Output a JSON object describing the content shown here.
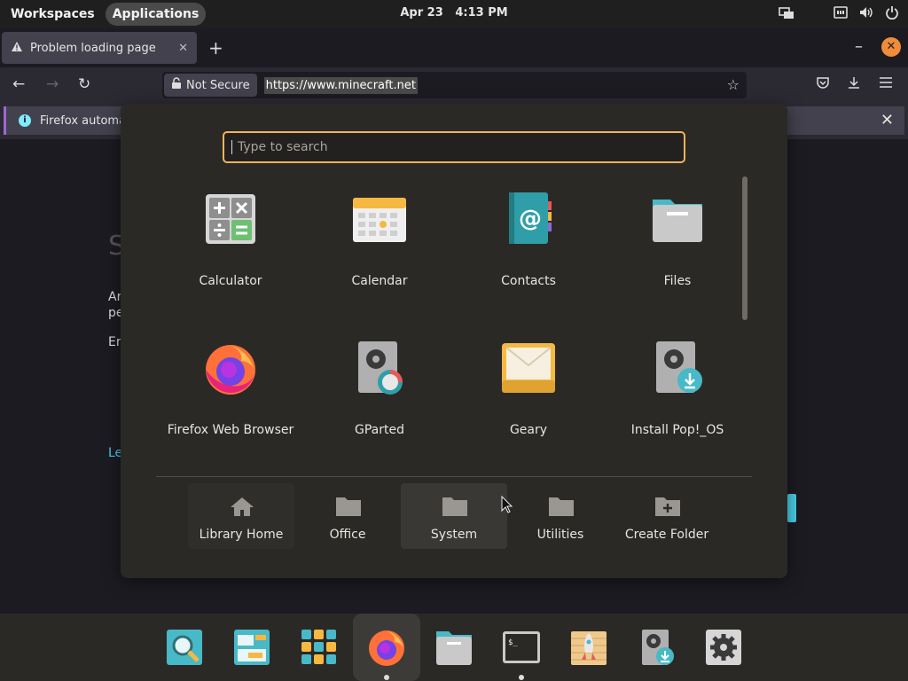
{
  "top_panel": {
    "workspaces": "Workspaces",
    "applications": "Applications",
    "date": "Apr 23",
    "time": "4:13 PM"
  },
  "firefox": {
    "tab_title": "Problem loading page",
    "security_label": "Not Secure",
    "url": "https://www.minecraft.net",
    "info_text": "Firefox automa",
    "page_fragments": [
      "S",
      "Ar",
      "pe",
      "Er",
      "Le"
    ]
  },
  "launcher": {
    "search_placeholder": "Type to search",
    "apps": [
      {
        "label": "Calculator",
        "icon": "calculator-icon"
      },
      {
        "label": "Calendar",
        "icon": "calendar-icon"
      },
      {
        "label": "Contacts",
        "icon": "contacts-icon"
      },
      {
        "label": "Files",
        "icon": "files-icon"
      },
      {
        "label": "Firefox Web Browser",
        "icon": "firefox-icon"
      },
      {
        "label": "GParted",
        "icon": "gparted-icon"
      },
      {
        "label": "Geary",
        "icon": "geary-icon"
      },
      {
        "label": "Install Pop!_OS",
        "icon": "installer-icon"
      }
    ],
    "folders": [
      {
        "label": "Library Home",
        "icon": "home-icon"
      },
      {
        "label": "Office",
        "icon": "folder-icon"
      },
      {
        "label": "System",
        "icon": "folder-icon"
      },
      {
        "label": "Utilities",
        "icon": "folder-icon"
      },
      {
        "label": "Create Folder",
        "icon": "folder-plus-icon"
      }
    ]
  },
  "dock": {
    "items": [
      "search-icon",
      "workspaces-icon",
      "app-grid-icon",
      "firefox-icon",
      "files-icon",
      "terminal-icon",
      "pop-shop-icon",
      "installer-icon",
      "settings-icon"
    ],
    "terminal_prompt": "$_"
  },
  "colors": {
    "accent": "#f0b45a",
    "launcher_bg": "#2b2926",
    "dock_bg": "#2b2926",
    "panel_bg": "#1f1f1f"
  }
}
